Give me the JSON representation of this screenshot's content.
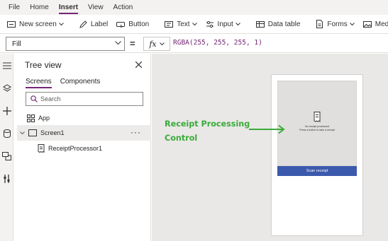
{
  "menubar": {
    "items": [
      "File",
      "Home",
      "Insert",
      "View",
      "Action"
    ],
    "active": "Insert"
  },
  "ribbon": {
    "new_screen": "New screen",
    "label": "Label",
    "button": "Button",
    "text": "Text",
    "input": "Input",
    "data_table": "Data table",
    "forms": "Forms",
    "media": "Media"
  },
  "formula_bar": {
    "property": "Fill",
    "equals": "=",
    "fx": "fx",
    "formula": "RGBA(255, 255, 255, 1)"
  },
  "tree_view": {
    "title": "Tree view",
    "tabs": [
      "Screens",
      "Components"
    ],
    "search_placeholder": "Search",
    "items": [
      {
        "label": "App"
      },
      {
        "label": "Screen1"
      },
      {
        "label": "ReceiptProcessor1"
      }
    ],
    "more": "···"
  },
  "phone_preview": {
    "line1": "No receipt processed",
    "line2": "Press a button to take a receipt",
    "scan_button": "Scan receipt"
  },
  "annotation": {
    "line1": "Receipt Processing",
    "line2": "Control",
    "color": "#3aab3a"
  },
  "colors": {
    "accent": "#742774",
    "scan_button": "#3b59ad"
  }
}
